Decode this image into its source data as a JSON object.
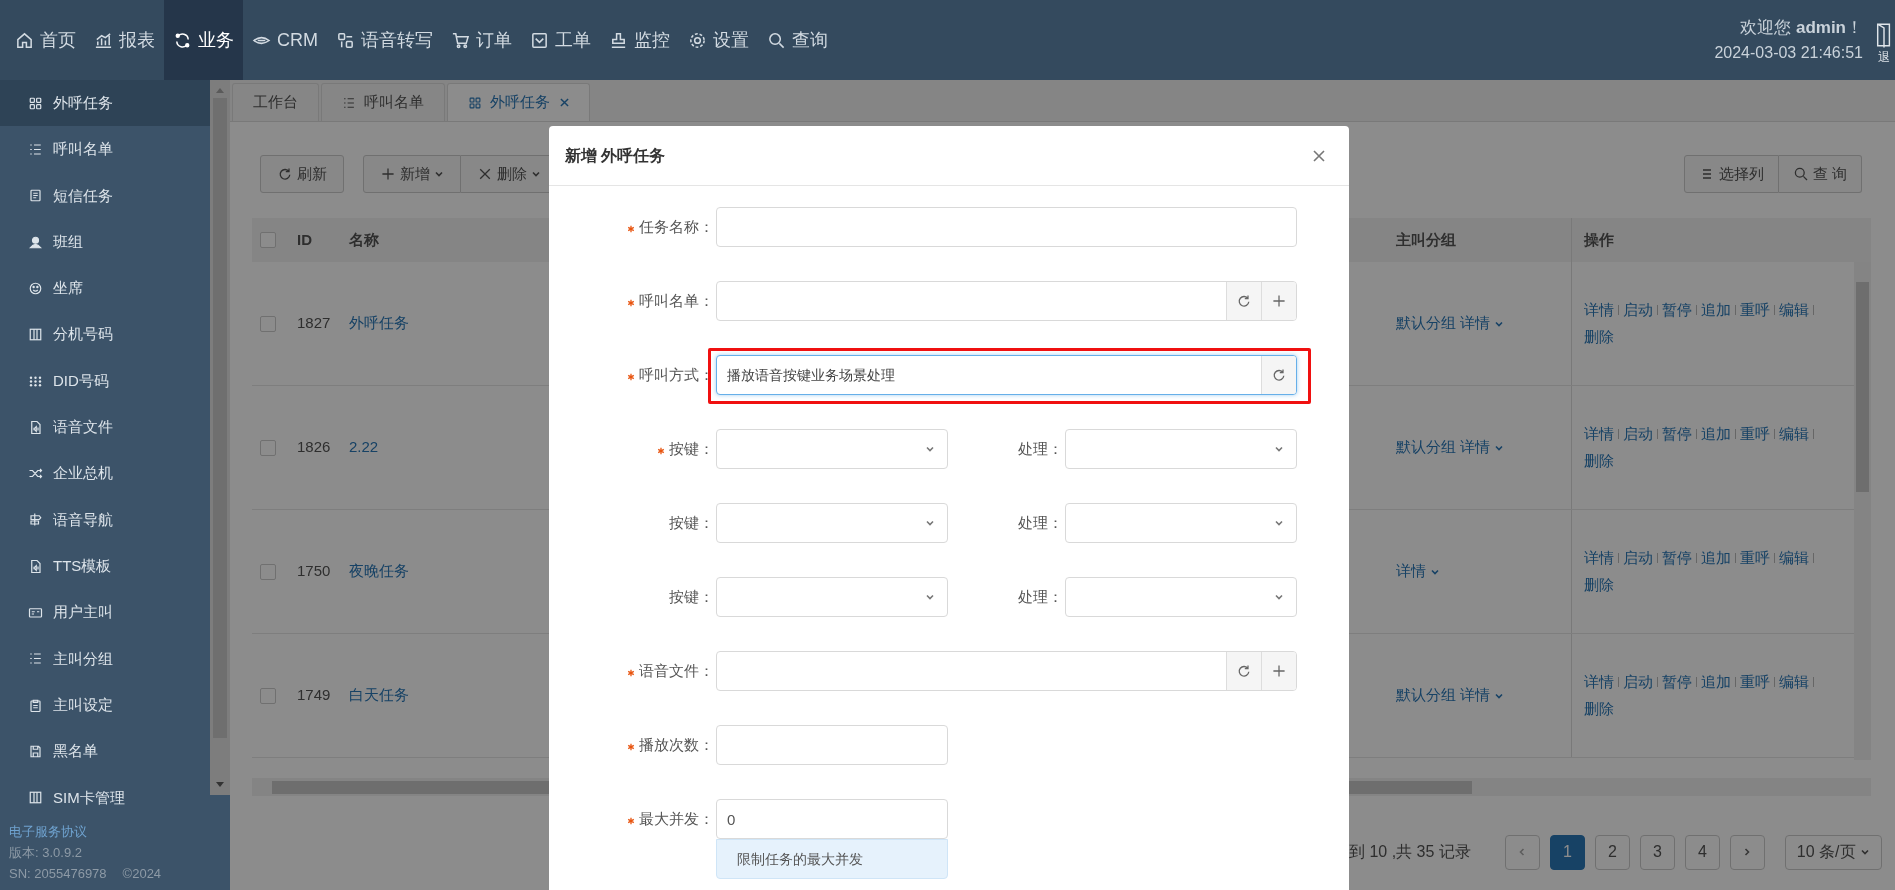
{
  "top_nav": {
    "items": [
      {
        "label": "首页",
        "selected": false
      },
      {
        "label": "报表",
        "selected": false
      },
      {
        "label": "业务",
        "selected": true
      },
      {
        "label": "CRM",
        "selected": false
      },
      {
        "label": "语音转写",
        "selected": false
      },
      {
        "label": "订单",
        "selected": false
      },
      {
        "label": "工单",
        "selected": false
      },
      {
        "label": "监控",
        "selected": false
      },
      {
        "label": "设置",
        "selected": false
      },
      {
        "label": "查询",
        "selected": false
      }
    ],
    "welcome": "欢迎您 **admin**！",
    "datetime": "2024-03-03 21:46:51",
    "logout": "退"
  },
  "sidebar": {
    "items": [
      {
        "label": "外呼任务",
        "selected": true
      },
      {
        "label": "呼叫名单",
        "selected": false
      },
      {
        "label": "短信任务",
        "selected": false
      },
      {
        "label": "班组",
        "selected": false
      },
      {
        "label": "坐席",
        "selected": false
      },
      {
        "label": "分机号码",
        "selected": false
      },
      {
        "label": "DID号码",
        "selected": false
      },
      {
        "label": "语音文件",
        "selected": false
      },
      {
        "label": "企业总机",
        "selected": false
      },
      {
        "label": "语音导航",
        "selected": false
      },
      {
        "label": "TTS模板",
        "selected": false
      },
      {
        "label": "用户主叫",
        "selected": false
      },
      {
        "label": "主叫分组",
        "selected": false
      },
      {
        "label": "主叫设定",
        "selected": false
      },
      {
        "label": "黑名单",
        "selected": false
      },
      {
        "label": "SIM卡管理",
        "selected": false
      }
    ],
    "footer": {
      "link": "电子服务协议",
      "version": "版本: 3.0.9.2",
      "serial": "SN: 2055476978",
      "copyright": "©2024"
    }
  },
  "tabs": [
    {
      "label": "工作台",
      "selected": false,
      "closable": false
    },
    {
      "label": "呼叫名单",
      "selected": false,
      "closable": false
    },
    {
      "label": "外呼任务",
      "selected": true,
      "closable": true
    }
  ],
  "toolbar": {
    "left": [
      {
        "label": "刷新",
        "kind": "refresh",
        "dropdown": false
      },
      {
        "label": "新增",
        "kind": "add",
        "dropdown": true
      },
      {
        "label": "删除",
        "kind": "delete",
        "dropdown": true
      }
    ],
    "right": [
      {
        "label": "选择列",
        "kind": "columns"
      },
      {
        "label": "查 询",
        "kind": "search"
      }
    ]
  },
  "table": {
    "columns": [
      "ID",
      "名称",
      "主叫分组",
      "操作"
    ],
    "all_checked": false,
    "rows": [
      {
        "checked": false,
        "id": "1827",
        "name": "外呼任务",
        "group": "默认分组 详情",
        "actions": [
          "详情",
          "启动",
          "暂停",
          "追加",
          "重呼",
          "编辑",
          "删除"
        ]
      },
      {
        "checked": false,
        "id": "1826",
        "name": "2.22",
        "group": "默认分组 详情",
        "actions": [
          "详情",
          "启动",
          "暂停",
          "追加",
          "重呼",
          "编辑",
          "删除"
        ]
      },
      {
        "checked": false,
        "id": "1750",
        "name": "夜晚任务",
        "group": "详情",
        "actions": [
          "详情",
          "启动",
          "暂停",
          "追加",
          "重呼",
          "编辑",
          "删除"
        ]
      },
      {
        "checked": false,
        "id": "1749",
        "name": "白天任务",
        "group": "默认分组 详情",
        "actions": [
          "详情",
          "启动",
          "暂停",
          "追加",
          "重呼",
          "编辑",
          "删除"
        ]
      }
    ]
  },
  "pagination": {
    "summary": "到 10 ,共 35 记录",
    "pages": [
      {
        "label": "1",
        "selected": true
      },
      {
        "label": "2",
        "selected": false
      },
      {
        "label": "3",
        "selected": false
      },
      {
        "label": "4",
        "selected": false
      }
    ],
    "page_size": "10 条/页"
  },
  "modal": {
    "title": "新增 外呼任务",
    "fields": [
      {
        "kind": "text",
        "label": "任务名称：",
        "required": true
      },
      {
        "kind": "picker",
        "label": "呼叫名单：",
        "required": true
      },
      {
        "kind": "mode",
        "label": "呼叫方式：",
        "required": true,
        "value": "播放语音按键业务场景处理",
        "focused": true,
        "highlighted": true
      },
      {
        "kind": "key_pair",
        "label": "按键：",
        "required": true,
        "second_label": "处理："
      },
      {
        "kind": "key_pair",
        "label": "按键：",
        "required": false,
        "second_label": "处理："
      },
      {
        "kind": "key_pair",
        "label": "按键：",
        "required": false,
        "second_label": "处理："
      },
      {
        "kind": "picker",
        "label": "语音文件：",
        "required": true
      },
      {
        "kind": "short",
        "label": "播放次数：",
        "required": true
      },
      {
        "kind": "short",
        "label": "最大并发：",
        "required": true,
        "value": "0",
        "hint": "限制任务的最大并发"
      }
    ]
  }
}
